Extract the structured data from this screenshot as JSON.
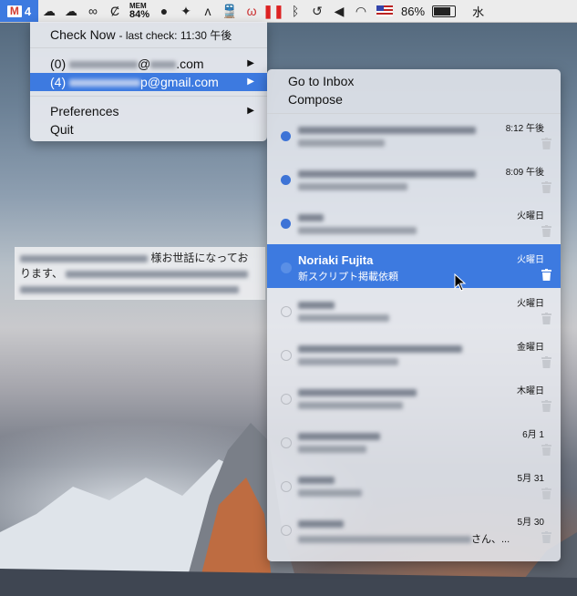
{
  "menubar": {
    "gmail_count": "4",
    "mem_label": "MEM",
    "mem_value": "84%",
    "battery": "86%",
    "clock": "水",
    "icons": [
      "gmail-icon",
      "cloud-icon",
      "cloud-outline-icon",
      "creative-cloud-icon",
      "cashew-icon",
      "circle-icon",
      "dropbox-icon",
      "script-icon",
      "train-icon",
      "omega-icon",
      "pause-icon",
      "bluetooth-icon",
      "time-machine-icon",
      "volume-icon",
      "wifi-icon",
      "us-flag-icon",
      "battery-icon"
    ]
  },
  "menu": {
    "check_now": "Check Now",
    "last_check": "- last check: 11:30 午後",
    "accounts": [
      {
        "count": "(0)",
        "address_suffix": "@",
        "domain": ".com"
      },
      {
        "count": "(4)",
        "address_suffix": "p@gmail.com"
      }
    ],
    "preferences": "Preferences",
    "quit": "Quit"
  },
  "submenu": {
    "go_to_inbox": "Go to Inbox",
    "compose": "Compose",
    "mails": [
      {
        "sender": "",
        "subject": "",
        "date": "8:12 午後",
        "unread": true
      },
      {
        "sender": "",
        "subject": "",
        "date": "8:09 午後",
        "unread": true
      },
      {
        "sender": "",
        "subject": "",
        "date": "火曜日",
        "unread": true
      },
      {
        "sender": "Noriaki Fujita",
        "subject": "新スクリプト掲載依頼",
        "date": "火曜日",
        "unread": false,
        "selected": true
      },
      {
        "sender": "",
        "subject": "",
        "date": "火曜日",
        "unread": false
      },
      {
        "sender": "",
        "subject": "",
        "date": "金曜日",
        "unread": false
      },
      {
        "sender": "",
        "subject": "",
        "date": "木曜日",
        "unread": false
      },
      {
        "sender": "",
        "subject": "",
        "date": "6月 1",
        "unread": false
      },
      {
        "sender": "",
        "subject": "",
        "date": "5月 31",
        "unread": false
      },
      {
        "sender": "",
        "subject": "さん、...",
        "date": "5月 30",
        "unread": false
      }
    ]
  },
  "background_window": {
    "line1": "様お世話になってお",
    "line2": "ります、"
  }
}
